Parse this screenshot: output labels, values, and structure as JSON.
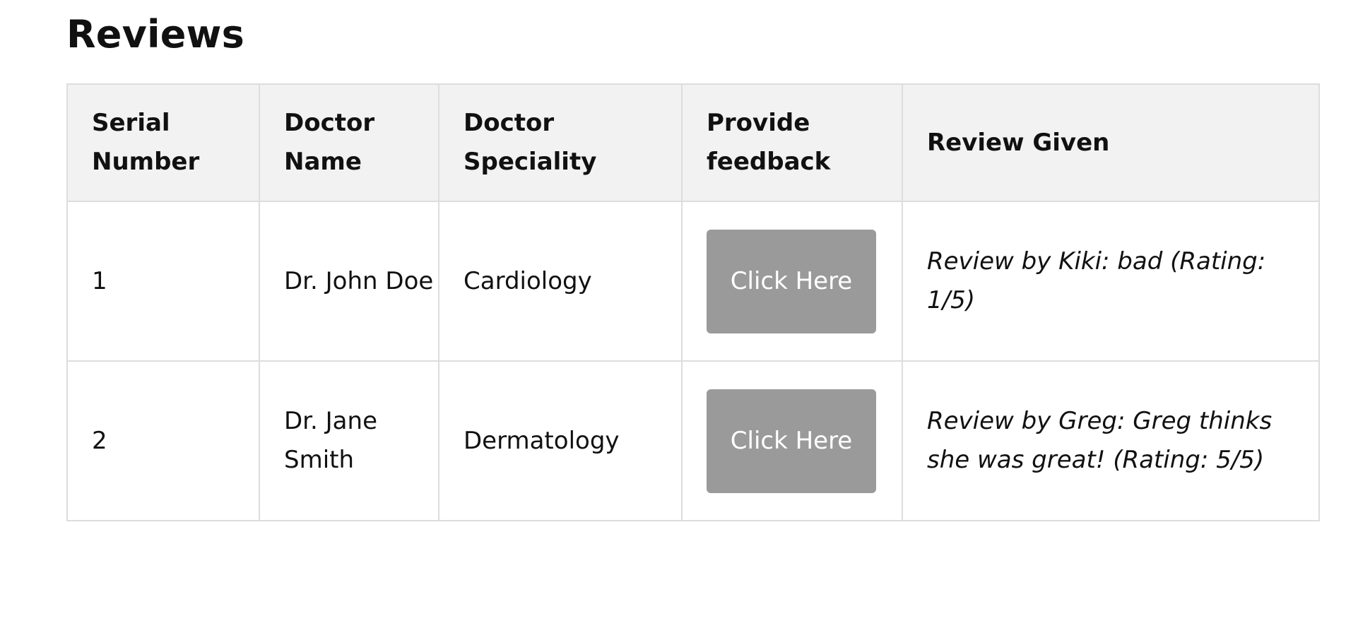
{
  "page": {
    "title": "Reviews"
  },
  "table": {
    "headers": [
      "Serial Number",
      "Doctor Name",
      "Doctor Speciality",
      "Provide feedback",
      "Review Given"
    ],
    "rows": [
      {
        "serial": "1",
        "doctor_name": "Dr. John Doe",
        "speciality": "Cardiology",
        "feedback_button": "Click Here",
        "review": "Review by Kiki: bad (Rating: 1/5)"
      },
      {
        "serial": "2",
        "doctor_name": "Dr. Jane Smith",
        "speciality": "Dermatology",
        "feedback_button": "Click Here",
        "review": "Review by Greg: Greg thinks she was great! (Rating: 5/5)"
      }
    ]
  },
  "colors": {
    "header_background": "#f2f2f2",
    "button_background": "#9a9a9a",
    "button_text": "#ffffff",
    "border": "#dddddd"
  }
}
